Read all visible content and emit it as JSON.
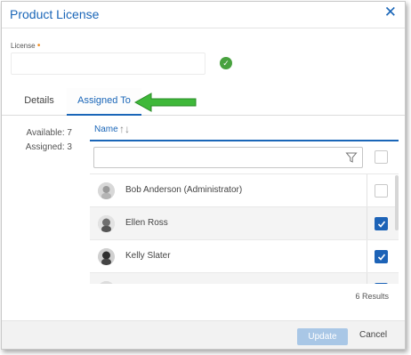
{
  "dialog": {
    "title": "Product License",
    "close_icon": "close-icon"
  },
  "license": {
    "label": "License",
    "required_marker": "•",
    "value": "",
    "status_icon": "check-circle-icon",
    "status_color": "#48a23f"
  },
  "tabs": [
    {
      "label": "Details",
      "active": false
    },
    {
      "label": "Assigned To",
      "active": true
    }
  ],
  "annotation": {
    "icon": "green-arrow-icon",
    "color": "#3fb83a"
  },
  "counts": {
    "available": "Available: 7",
    "assigned": "Assigned: 3"
  },
  "table": {
    "column_name": "Name",
    "sort_icon": "sort-icon",
    "filter_placeholder": "",
    "filter_icon": "filter-icon",
    "rows": [
      {
        "name": "Bob Anderson (Administrator)",
        "checked": false
      },
      {
        "name": "Ellen Ross",
        "checked": true
      },
      {
        "name": "Kelly Slater",
        "checked": true
      },
      {
        "name": "",
        "checked": true
      }
    ],
    "results": "6 Results"
  },
  "footer": {
    "update_label": "Update",
    "cancel_label": "Cancel"
  },
  "colors": {
    "accent": "#1a66b8",
    "checkbox_on": "#1d63b7",
    "update_disabled": "#a9c7e6"
  }
}
